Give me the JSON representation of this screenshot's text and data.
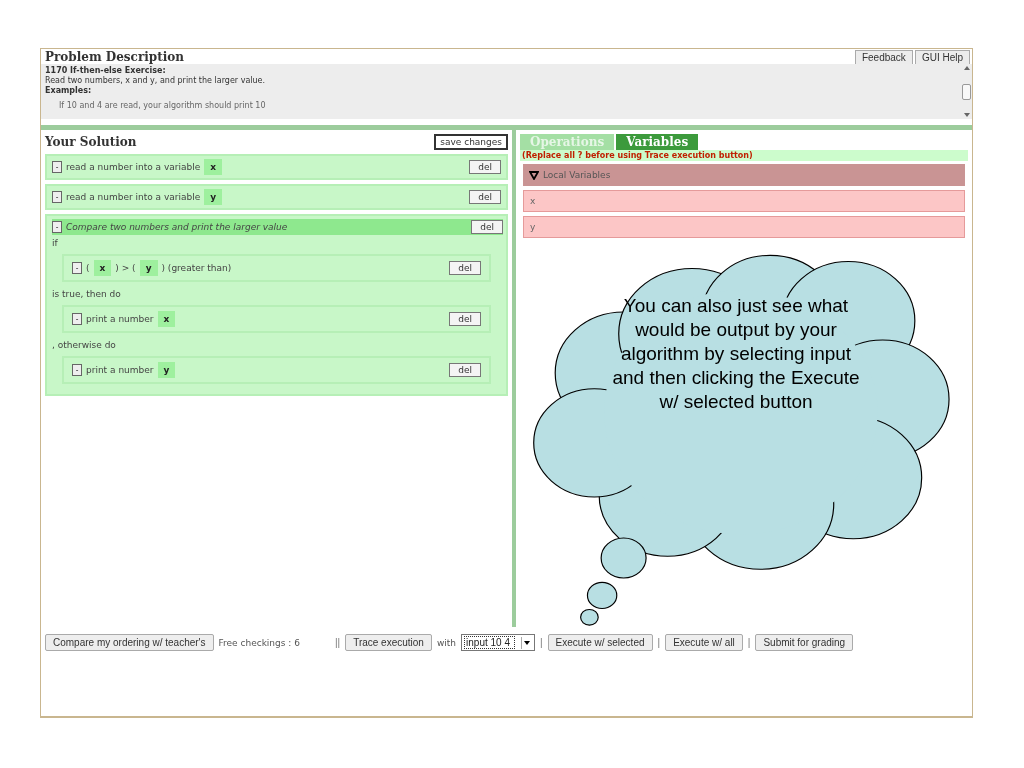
{
  "problem": {
    "title": "Problem Description",
    "exercise": "1170 If-then-else Exercise:",
    "description": "Read two numbers, x and y, and print the larger value.",
    "examples_label": "Examples:",
    "example_line": "If 10 and 4 are read, your algorithm should print 10"
  },
  "header_buttons": [
    "Feedback",
    "GUI Help"
  ],
  "solution": {
    "title": "Your Solution",
    "save_button": "save changes",
    "blocks": [
      {
        "kind": "statement",
        "minus": "-",
        "parts": [
          {
            "kind": "text",
            "text": "read a number into a variable"
          },
          {
            "kind": "var",
            "text": "x"
          }
        ],
        "del": "del"
      },
      {
        "kind": "statement",
        "minus": "-",
        "parts": [
          {
            "kind": "text",
            "text": "read a number into a variable"
          },
          {
            "kind": "var",
            "text": "y"
          }
        ],
        "del": "del"
      },
      {
        "kind": "if",
        "minus": "-",
        "title": "Compare two numbers and print the larger value",
        "del": "del",
        "if_label": "if",
        "condition": {
          "kind": "statement",
          "minus": "-",
          "parts": [
            {
              "kind": "text",
              "text": "("
            },
            {
              "kind": "var",
              "text": "x"
            },
            {
              "kind": "text",
              "text": ") > ("
            },
            {
              "kind": "var",
              "text": "y"
            },
            {
              "kind": "text",
              "text": ") (greater than)"
            }
          ],
          "del": "del"
        },
        "then_label": "is true, then do",
        "then": [
          {
            "kind": "statement",
            "minus": "-",
            "parts": [
              {
                "kind": "text",
                "text": "print a number"
              },
              {
                "kind": "var",
                "text": "x"
              }
            ],
            "del": "del"
          }
        ],
        "else_label": ", otherwise do",
        "else": [
          {
            "kind": "statement",
            "minus": "-",
            "parts": [
              {
                "kind": "text",
                "text": "print a number"
              },
              {
                "kind": "var",
                "text": "y"
              }
            ],
            "del": "del"
          }
        ]
      }
    ]
  },
  "tabs": [
    {
      "label": "Operations",
      "selected": false
    },
    {
      "label": "Variables",
      "selected": true
    }
  ],
  "notice": "(Replace all ? before using Trace execution button)",
  "variables_section": {
    "label": "Local Variables",
    "expanded": true,
    "items": [
      "x",
      "y"
    ]
  },
  "toolbar": [
    {
      "kind": "button",
      "text": "Compare my ordering w/ teacher's"
    },
    {
      "kind": "text",
      "text": "Free checkings : 6"
    },
    {
      "kind": "sep",
      "text": "||"
    },
    {
      "kind": "button",
      "text": "Trace execution"
    },
    {
      "kind": "text",
      "text": "with"
    },
    {
      "kind": "select",
      "text": "input 10 4"
    },
    {
      "kind": "sep",
      "text": "|"
    },
    {
      "kind": "button",
      "text": "Execute w/ selected"
    },
    {
      "kind": "sep",
      "text": "|"
    },
    {
      "kind": "button",
      "text": "Execute w/ all"
    },
    {
      "kind": "sep",
      "text": "|"
    },
    {
      "kind": "button",
      "text": "Submit for grading"
    }
  ],
  "callout": {
    "text": "You can also just see what would be output by your algorithm by selecting input and then clicking the Execute w/ selected button"
  }
}
